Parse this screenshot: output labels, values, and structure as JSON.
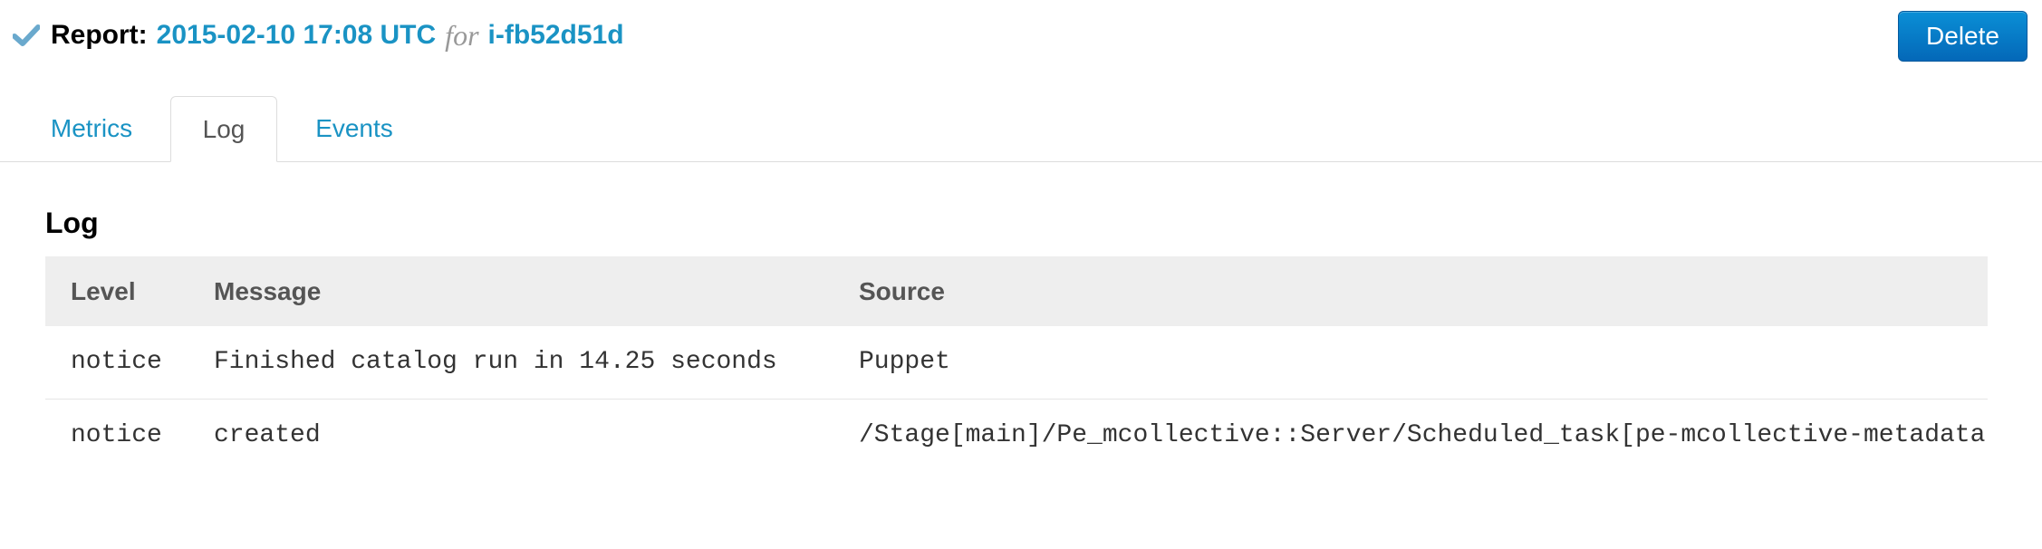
{
  "header": {
    "report_label": "Report:",
    "timestamp": "2015-02-10 17:08 UTC",
    "for_text": "for",
    "node": "i-fb52d51d",
    "status_icon": "check-icon",
    "status_color": "#6aa9cd"
  },
  "actions": {
    "delete_label": "Delete"
  },
  "tabs": [
    {
      "label": "Metrics",
      "active": false
    },
    {
      "label": "Log",
      "active": true
    },
    {
      "label": "Events",
      "active": false
    }
  ],
  "log": {
    "title": "Log",
    "columns": [
      "Level",
      "Message",
      "Source"
    ],
    "rows": [
      {
        "level": "notice",
        "message": "Finished catalog run in 14.25 seconds",
        "source": "Puppet"
      },
      {
        "level": "notice",
        "message": "created",
        "source": "/Stage[main]/Pe_mcollective::Server/Scheduled_task[pe-mcollective-metadata]"
      }
    ]
  },
  "colors": {
    "link": "#1a93c4",
    "button": "#0a7fcc",
    "table_header_bg": "#eeeeee"
  }
}
